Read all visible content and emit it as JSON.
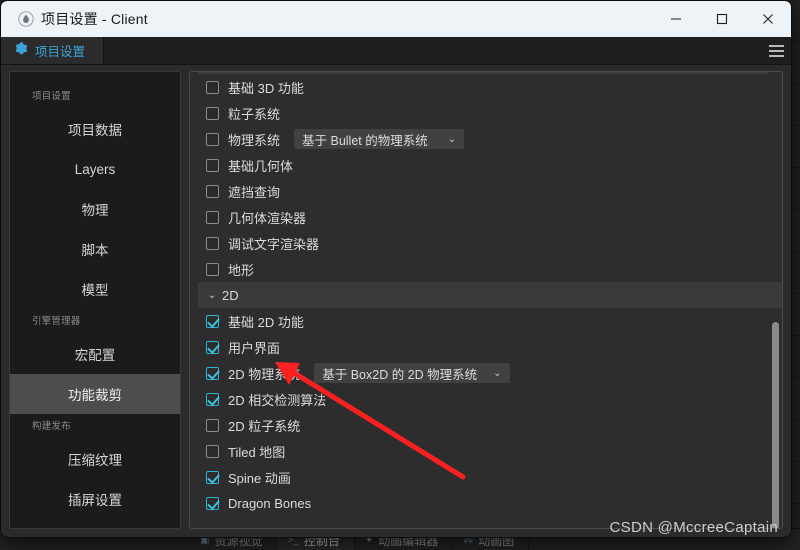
{
  "window": {
    "title": "项目设置 - Client",
    "app_icon": "water-drop-icon",
    "controls": {
      "minimize": "—",
      "maximize": "☐",
      "close": "✕"
    }
  },
  "tabbar": {
    "tabs": [
      {
        "label": "项目设置",
        "icon": "gear-icon",
        "active": true
      }
    ],
    "menu_icon": "hamburger-icon"
  },
  "sidebar": {
    "groups": [
      {
        "title": "项目设置",
        "items": [
          {
            "label": "项目数据",
            "selected": false
          },
          {
            "label": "Layers",
            "selected": false
          },
          {
            "label": "物理",
            "selected": false
          },
          {
            "label": "脚本",
            "selected": false
          },
          {
            "label": "模型",
            "selected": false
          }
        ]
      },
      {
        "title": "引擎管理器",
        "items": [
          {
            "label": "宏配置",
            "selected": false
          },
          {
            "label": "功能裁剪",
            "selected": true
          }
        ]
      },
      {
        "title": "构建发布",
        "items": [
          {
            "label": "压缩纹理",
            "selected": false
          },
          {
            "label": "插屏设置",
            "selected": false
          }
        ]
      }
    ]
  },
  "content": {
    "rows": [
      {
        "type": "check",
        "label": "基础 3D 功能",
        "checked": false
      },
      {
        "type": "check",
        "label": "粒子系统",
        "checked": false
      },
      {
        "type": "check",
        "label": "物理系统",
        "checked": false,
        "dropdown": "基于 Bullet 的物理系统",
        "dropdown_wide": true
      },
      {
        "type": "check",
        "label": "基础几何体",
        "checked": false
      },
      {
        "type": "check",
        "label": "遮挡查询",
        "checked": false
      },
      {
        "type": "check",
        "label": "几何体渲染器",
        "checked": false
      },
      {
        "type": "check",
        "label": "调试文字渲染器",
        "checked": false
      },
      {
        "type": "check",
        "label": "地形",
        "checked": false
      },
      {
        "type": "group",
        "label": "2D",
        "expanded": true
      },
      {
        "type": "check",
        "label": "基础 2D 功能",
        "checked": true
      },
      {
        "type": "check",
        "label": "用户界面",
        "checked": true
      },
      {
        "type": "check",
        "label": "2D 物理系统",
        "checked": true,
        "dropdown": "基于 Box2D 的 2D 物理系统",
        "dropdown_wide": true
      },
      {
        "type": "check",
        "label": "2D 相交检测算法",
        "checked": true
      },
      {
        "type": "check",
        "label": "2D 粒子系统",
        "checked": false
      },
      {
        "type": "check",
        "label": "Tiled 地图",
        "checked": false
      },
      {
        "type": "check",
        "label": "Spine 动画",
        "checked": true
      },
      {
        "type": "check",
        "label": "Dragon Bones",
        "checked": true
      }
    ],
    "scrollbar": "vertical-scrollbar"
  },
  "background": {
    "tabs": [
      {
        "label": "资源视觉",
        "icon": "assets-icon"
      },
      {
        "label": "控制台",
        "icon": "console-icon"
      },
      {
        "label": "动画编辑器",
        "icon": "anim-editor-icon"
      },
      {
        "label": "动画图",
        "icon": "anim-graph-icon"
      }
    ]
  },
  "annotation": {
    "arrow_color": "#ff2020",
    "shape": "red-arrow"
  },
  "watermark": {
    "text": "CSDN @MccreeCaptain"
  },
  "colors": {
    "accent": "#3ea4d8",
    "check": "#3fc1e0",
    "selected_row": "#4d4d4d",
    "titlebar": "#eef3f8"
  }
}
